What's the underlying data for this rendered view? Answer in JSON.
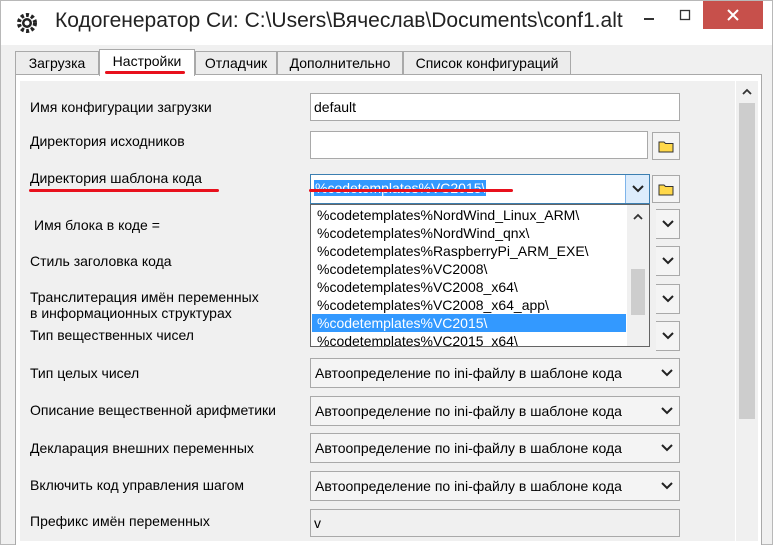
{
  "window": {
    "title": "Кодогенератор Си: C:\\Users\\Вячеслав\\Documents\\conf1.alt"
  },
  "tabs": [
    {
      "label": "Загрузка"
    },
    {
      "label": "Настройки",
      "active": true
    },
    {
      "label": "Отладчик"
    },
    {
      "label": "Дополнительно"
    },
    {
      "label": "Список конфигураций"
    }
  ],
  "form": {
    "load_config_name": {
      "label": "Имя конфигурации загрузки",
      "value": "default"
    },
    "source_dir": {
      "label": "Директория исходников",
      "value": ""
    },
    "template_dir": {
      "label": "Директория шаблона кода",
      "value": "%codetemplates%VC2015\\"
    },
    "block_name": {
      "label": "Имя блока в коде ="
    },
    "header_style": {
      "label": "Стиль заголовка кода"
    },
    "transliteration": {
      "label_line1": "Транслитерация имён переменных",
      "label_line2": "в информационных структурах"
    },
    "real_type": {
      "label": "Тип вещественных чисел"
    },
    "int_type": {
      "label": "Тип целых чисел",
      "value": "Автоопределение по ini-файлу в шаблоне кода"
    },
    "real_arith": {
      "label": "Описание вещественной арифметики",
      "value": "Автоопределение по ini-файлу в шаблоне кода"
    },
    "extern_decl": {
      "label": "Декларация внешних переменных",
      "value": "Автоопределение по ini-файлу в шаблоне кода"
    },
    "step_control": {
      "label": "Включить код управления шагом",
      "value": "Автоопределение по ini-файлу в шаблоне кода"
    },
    "var_prefix": {
      "label": "Префикс имён переменных",
      "value": "v"
    }
  },
  "dropdown": {
    "items": [
      "%codetemplates%NordWind_Linux_ARM\\",
      "%codetemplates%NordWind_qnx\\",
      "%codetemplates%RaspberryPi_ARM_EXE\\",
      "%codetemplates%VC2008\\",
      "%codetemplates%VC2008_x64\\",
      "%codetemplates%VC2008_x64_app\\",
      "%codetemplates%VC2015\\",
      "%codetemplates%VC2015_x64\\"
    ],
    "selected_index": 6
  },
  "colors": {
    "selection": "#3399ff",
    "annotation": "#e8101c",
    "close_button": "#c7504b"
  }
}
